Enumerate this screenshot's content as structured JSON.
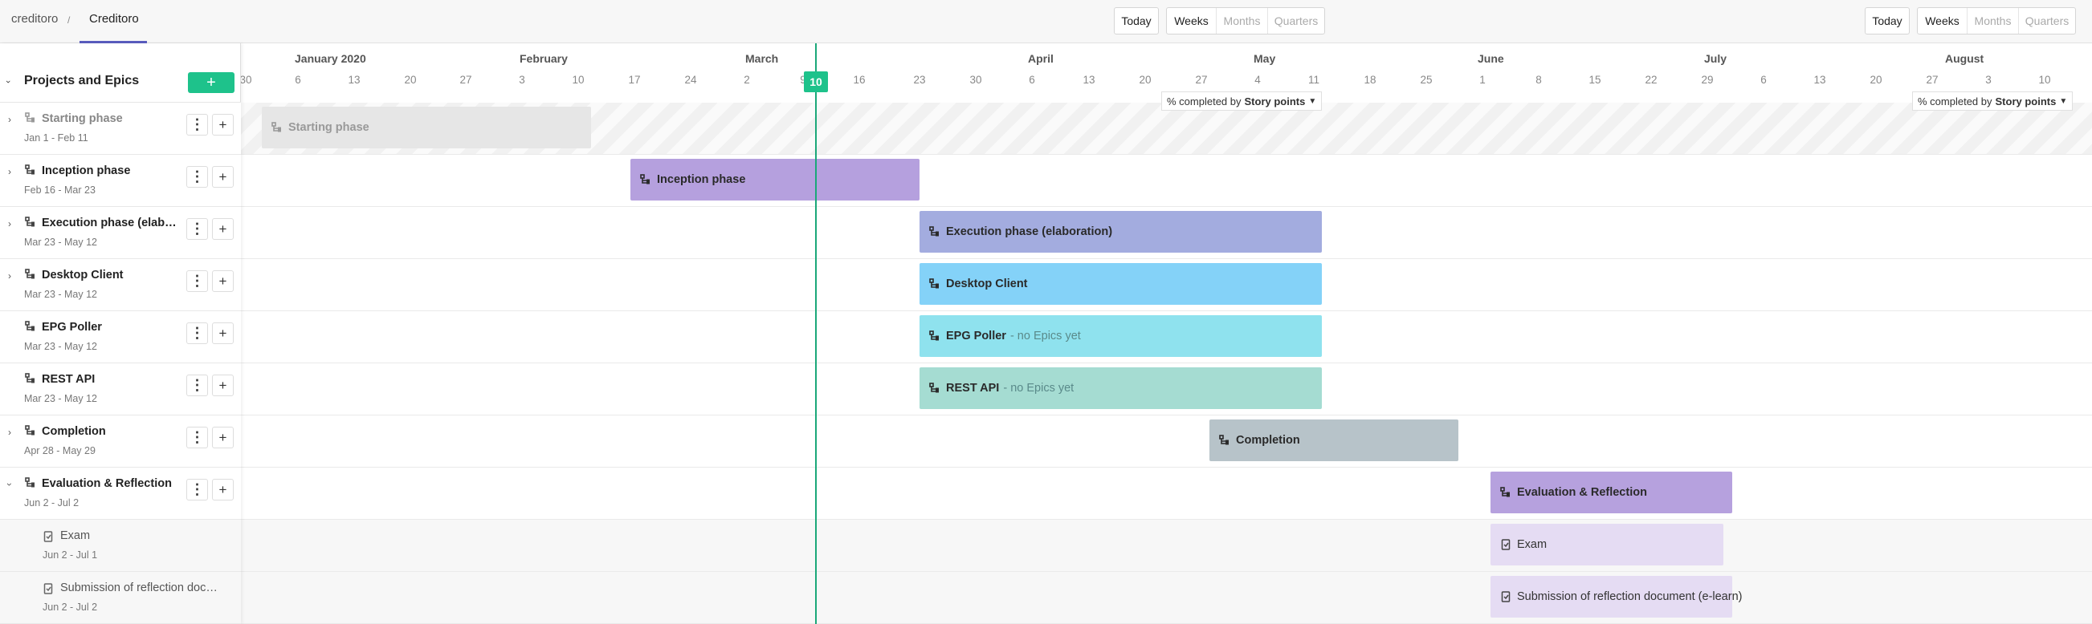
{
  "breadcrumb": {
    "root": "creditoro",
    "separator": "/",
    "current": "Creditoro"
  },
  "toolbar_left": {
    "today": "Today",
    "weeks": "Weeks",
    "months": "Months",
    "quarters": "Quarters"
  },
  "toolbar_right": {
    "today": "Today",
    "weeks": "Weeks",
    "months": "Months",
    "quarters": "Quarters"
  },
  "sidebar": {
    "title": "Projects and Epics",
    "add_label": "+",
    "menu_label": "⋮",
    "plus_label": "+"
  },
  "timeline": {
    "year_month": "January 2020",
    "months": [
      "February",
      "March",
      "April",
      "May",
      "June",
      "July",
      "August"
    ],
    "weeks": [
      "30",
      "6",
      "13",
      "20",
      "27",
      "3",
      "10",
      "17",
      "24",
      "2",
      "9",
      "16",
      "23",
      "30",
      "6",
      "13",
      "20",
      "27",
      "4",
      "11",
      "18",
      "25",
      "1",
      "8",
      "15",
      "22",
      "29",
      "6",
      "13",
      "20",
      "27",
      "3",
      "10"
    ],
    "today": "10"
  },
  "progress_selector": {
    "prefix": "% completed by",
    "metric": "Story points"
  },
  "rows": [
    {
      "name": "Starting phase",
      "dates": "Jan 1 - Feb 11",
      "bar_label": "Starting phase",
      "note": "",
      "color": "#e6e6e6",
      "text_color": "#999",
      "expanded": false,
      "past": true
    },
    {
      "name": "Inception phase",
      "dates": "Feb 16 - Mar 23",
      "bar_label": "Inception phase",
      "note": "",
      "color": "#b5a0de",
      "text_color": "#2a2a2a",
      "expanded": false
    },
    {
      "name": "Execution phase (elaboration)",
      "dates": "Mar 23 - May 12",
      "bar_label": "Execution phase (elaboration)",
      "note": "",
      "color": "#a3acdf",
      "text_color": "#2a2a2a",
      "expanded": false
    },
    {
      "name": "Desktop Client",
      "dates": "Mar 23 - May 12",
      "bar_label": "Desktop Client",
      "note": "",
      "color": "#84d2f8",
      "text_color": "#2a2a2a",
      "expanded": false
    },
    {
      "name": "EPG Poller",
      "dates": "Mar 23 - May 12",
      "bar_label": "EPG Poller",
      "note": "- no Epics yet",
      "color": "#8fe2ee",
      "text_color": "#2a2a2a",
      "no_expander": true
    },
    {
      "name": "REST API",
      "dates": "Mar 23 - May 12",
      "bar_label": "REST API",
      "note": "- no Epics yet",
      "color": "#a5dcd2",
      "text_color": "#2a2a2a",
      "no_expander": true
    },
    {
      "name": "Completion",
      "dates": "Apr 28 - May 29",
      "bar_label": "Completion",
      "note": "",
      "color": "#b7c3c9",
      "text_color": "#2a2a2a",
      "expanded": false
    },
    {
      "name": "Evaluation & Reflection",
      "dates": "Jun 2 - Jul 2",
      "bar_label": "Evaluation & Reflection",
      "note": "",
      "color": "#b6a1de",
      "text_color": "#2a2a2a",
      "expanded": true
    }
  ],
  "epics": [
    {
      "name": "Exam",
      "dates": "Jun 2 - Jul 1",
      "bar_label": "Exam",
      "color": "#e5dcf3"
    },
    {
      "name": "Submission of reflection document (e-learn)",
      "dates": "Jun 2 - Jul 2",
      "bar_label": "Submission of reflection document (e-learn)",
      "color": "#e5dcf3"
    }
  ]
}
